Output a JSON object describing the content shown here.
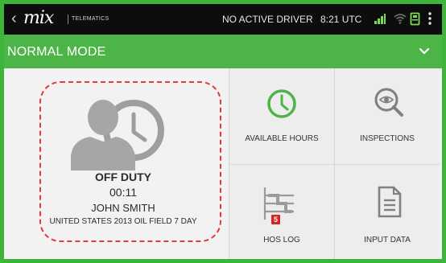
{
  "status_bar": {
    "back_glyph": "‹",
    "logo_text": "mix",
    "logo_subtext": "TELEMATICS",
    "driver_status": "NO ACTIVE DRIVER",
    "time": "8:21 UTC",
    "icons": [
      "signal-icon",
      "wifi-icon",
      "fuel-pump-icon",
      "overflow-menu-icon"
    ]
  },
  "mode_bar": {
    "title": "NORMAL MODE",
    "chevron_icon": "chevron-down-icon"
  },
  "driver_panel": {
    "avatar_icon": "driver-clock-icon",
    "duty_status": "OFF DUTY",
    "duty_time": "00:11",
    "driver_name": "JOHN SMITH",
    "ruleset": "UNITED STATES 2013 OIL FIELD 7 DAY"
  },
  "tiles": [
    {
      "label": "AVAILABLE HOURS",
      "icon": "clock-icon"
    },
    {
      "label": "INSPECTIONS",
      "icon": "inspection-eye-icon"
    },
    {
      "label": "HOS LOG",
      "icon": "hos-log-icon",
      "badge": "5"
    },
    {
      "label": "INPUT DATA",
      "icon": "document-icon"
    }
  ],
  "colors": {
    "brand_green": "#4db548",
    "frame_green": "#3db53a",
    "status_bar_bg": "#0d0d0d",
    "signal_green": "#7ed957",
    "badge_red": "#d42424",
    "highlight_red": "#e23b3b"
  }
}
